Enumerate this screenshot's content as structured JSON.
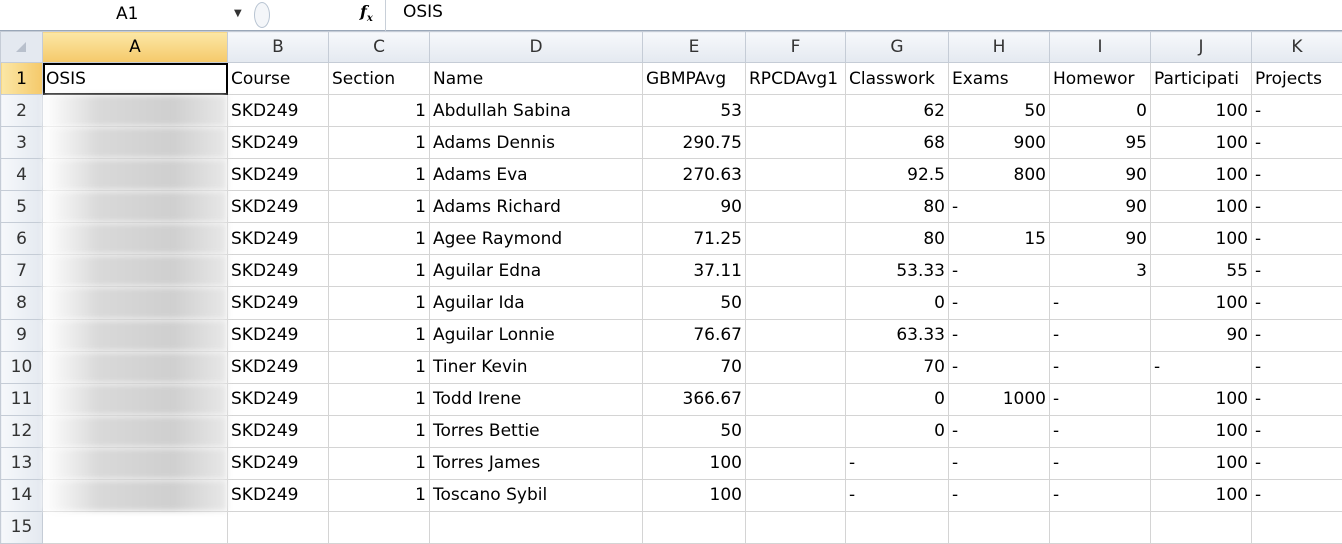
{
  "formula_bar": {
    "name_box": "A1",
    "fx_icon": "fx-icon",
    "value": "OSIS"
  },
  "columns": [
    "A",
    "B",
    "C",
    "D",
    "E",
    "F",
    "G",
    "H",
    "I",
    "J",
    "K"
  ],
  "row_numbers": [
    "1",
    "2",
    "3",
    "4",
    "5",
    "6",
    "7",
    "8",
    "9",
    "10",
    "11",
    "12",
    "13",
    "14",
    "15"
  ],
  "header_row": [
    "OSIS",
    "Course",
    "Section",
    "Name",
    "GBMPAvg",
    "RPCDAvg1",
    "Classwork",
    "Exams",
    "Homewor",
    "Participati",
    "Projects"
  ],
  "rows": [
    [
      "",
      "SKD249",
      "1",
      "Abdullah Sabina",
      "53",
      "",
      "62",
      "50",
      "0",
      "100",
      "-"
    ],
    [
      "",
      "SKD249",
      "1",
      "Adams Dennis",
      "290.75",
      "",
      "68",
      "900",
      "95",
      "100",
      "-"
    ],
    [
      "",
      "SKD249",
      "1",
      "Adams Eva",
      "270.63",
      "",
      "92.5",
      "800",
      "90",
      "100",
      "-"
    ],
    [
      "",
      "SKD249",
      "1",
      "Adams Richard",
      "90",
      "",
      "80",
      "-",
      "90",
      "100",
      "-"
    ],
    [
      "",
      "SKD249",
      "1",
      "Agee Raymond",
      "71.25",
      "",
      "80",
      "15",
      "90",
      "100",
      "-"
    ],
    [
      "",
      "SKD249",
      "1",
      "Aguilar Edna",
      "37.11",
      "",
      "53.33",
      "-",
      "3",
      "55",
      "-"
    ],
    [
      "",
      "SKD249",
      "1",
      "Aguilar Ida",
      "50",
      "",
      "0",
      "-",
      "-",
      "100",
      "-"
    ],
    [
      "",
      "SKD249",
      "1",
      "Aguilar Lonnie",
      "76.67",
      "",
      "63.33",
      "-",
      "-",
      "90",
      "-"
    ],
    [
      "",
      "SKD249",
      "1",
      "Tiner Kevin",
      "70",
      "",
      "70",
      "-",
      "-",
      "-",
      "-"
    ],
    [
      "",
      "SKD249",
      "1",
      "Todd Irene",
      "366.67",
      "",
      "0",
      "1000",
      "-",
      "100",
      "-"
    ],
    [
      "",
      "SKD249",
      "1",
      "Torres Bettie",
      "50",
      "",
      "0",
      "-",
      "-",
      "100",
      "-"
    ],
    [
      "",
      "SKD249",
      "1",
      "Torres James",
      "100",
      "",
      "-",
      "-",
      "-",
      "100",
      "-"
    ],
    [
      "",
      "SKD249",
      "1",
      "Toscano Sybil",
      "100",
      "",
      "-",
      "-",
      "-",
      "100",
      "-"
    ]
  ],
  "colors": {
    "active_header": "#f5c96a",
    "grid_line": "#d4d4d4"
  }
}
